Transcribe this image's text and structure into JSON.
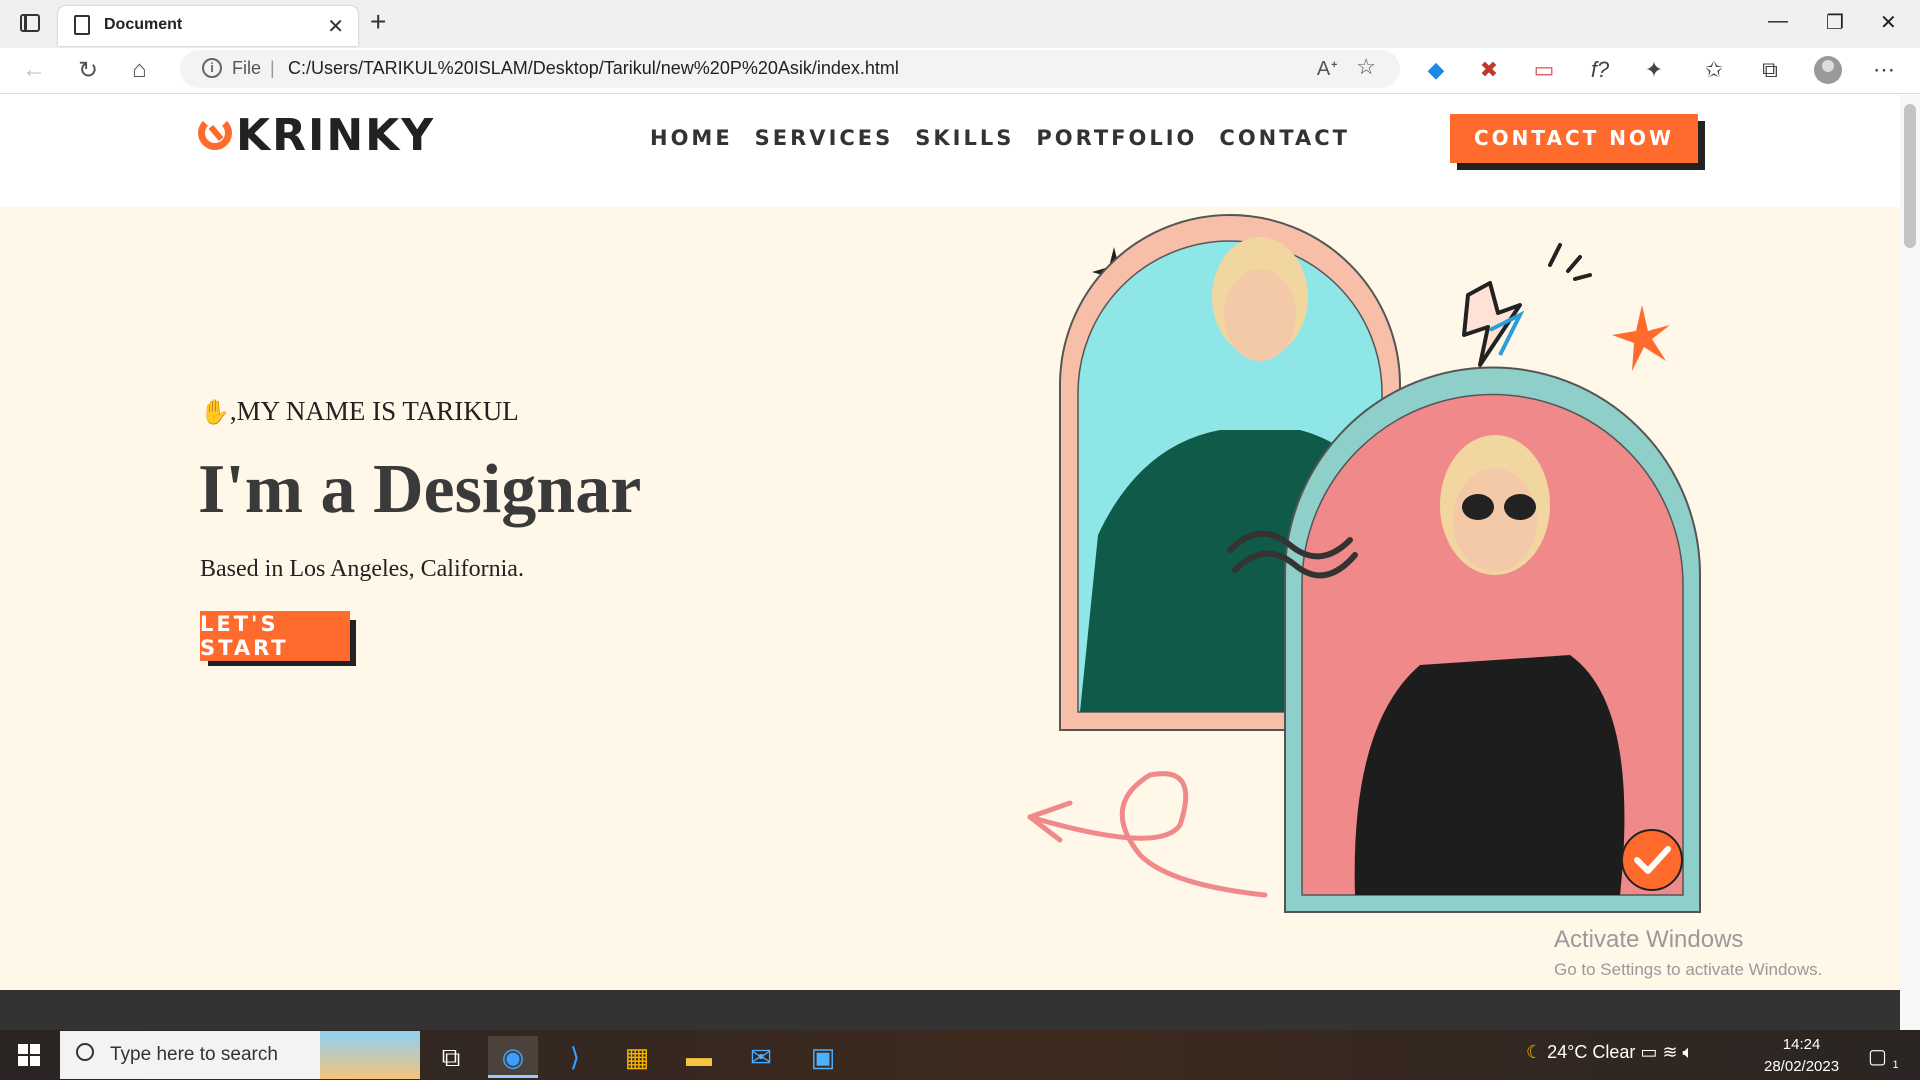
{
  "browser": {
    "tab_title": "Document",
    "file_label": "File",
    "url": "C:/Users/TARIKUL%20ISLAM/Desktop/Tarikul/new%20P%20Asik/index.html"
  },
  "site": {
    "logo_text": "KRINKY",
    "nav": [
      "HOME",
      "SERVICES",
      "SKILLS",
      "PORTFOLIO",
      "CONTACT"
    ],
    "cta_label": "CONTACT NOW",
    "greeting": ",MY NAME IS TARIKUL",
    "headline": "I'm a Designar",
    "subtitle": "Based in Los Angeles, California.",
    "start_label": "LET'S START"
  },
  "watermark": {
    "line1": "Activate Windows",
    "line2": "Go to Settings to activate Windows."
  },
  "taskbar": {
    "search_placeholder": "Type here to search",
    "weather": "24°C  Clear",
    "time": "14:24",
    "date": "28/02/2023",
    "notification_count": "1"
  },
  "colors": {
    "accent": "#ff6b2c",
    "hero_bg": "#fff7e8",
    "arch_peach": "#f7bfa8",
    "arch_teal": "#8ecfc9",
    "photo_cyan": "#8ee6e6",
    "photo_pink": "#f08a8a"
  }
}
